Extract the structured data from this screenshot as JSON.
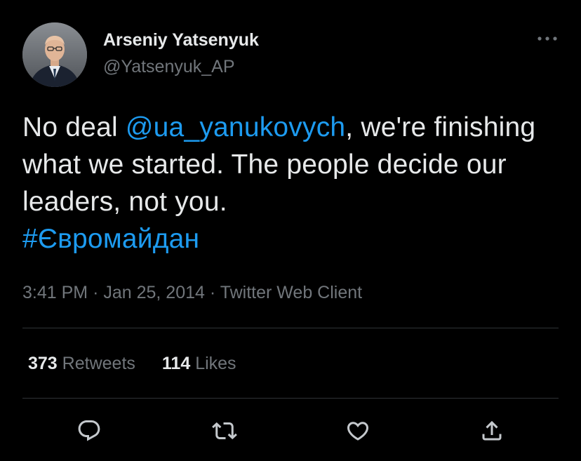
{
  "author": {
    "name": "Arseniy Yatsenyuk",
    "handle": "@Yatsenyuk_AP",
    "avatar_icon": "profile-photo"
  },
  "tweet": {
    "text_before": "No deal ",
    "mention": "@ua_yanukovych",
    "text_after": ", we're finishing what we started. The people decide our leaders, not you.",
    "hashtag": "#Євромайдан"
  },
  "meta": {
    "time": "3:41 PM",
    "separator": "·",
    "date": "Jan 25, 2014",
    "source": "Twitter Web Client"
  },
  "stats": {
    "retweets_count": "373",
    "retweets_label": "Retweets",
    "likes_count": "114",
    "likes_label": "Likes"
  },
  "actions": [
    "reply-icon",
    "retweet-icon",
    "like-icon",
    "share-icon"
  ],
  "colors": {
    "background": "#000000",
    "text": "#e7e9ea",
    "secondary": "#71767b",
    "link": "#1d9bf0",
    "divider": "#2f3336"
  }
}
